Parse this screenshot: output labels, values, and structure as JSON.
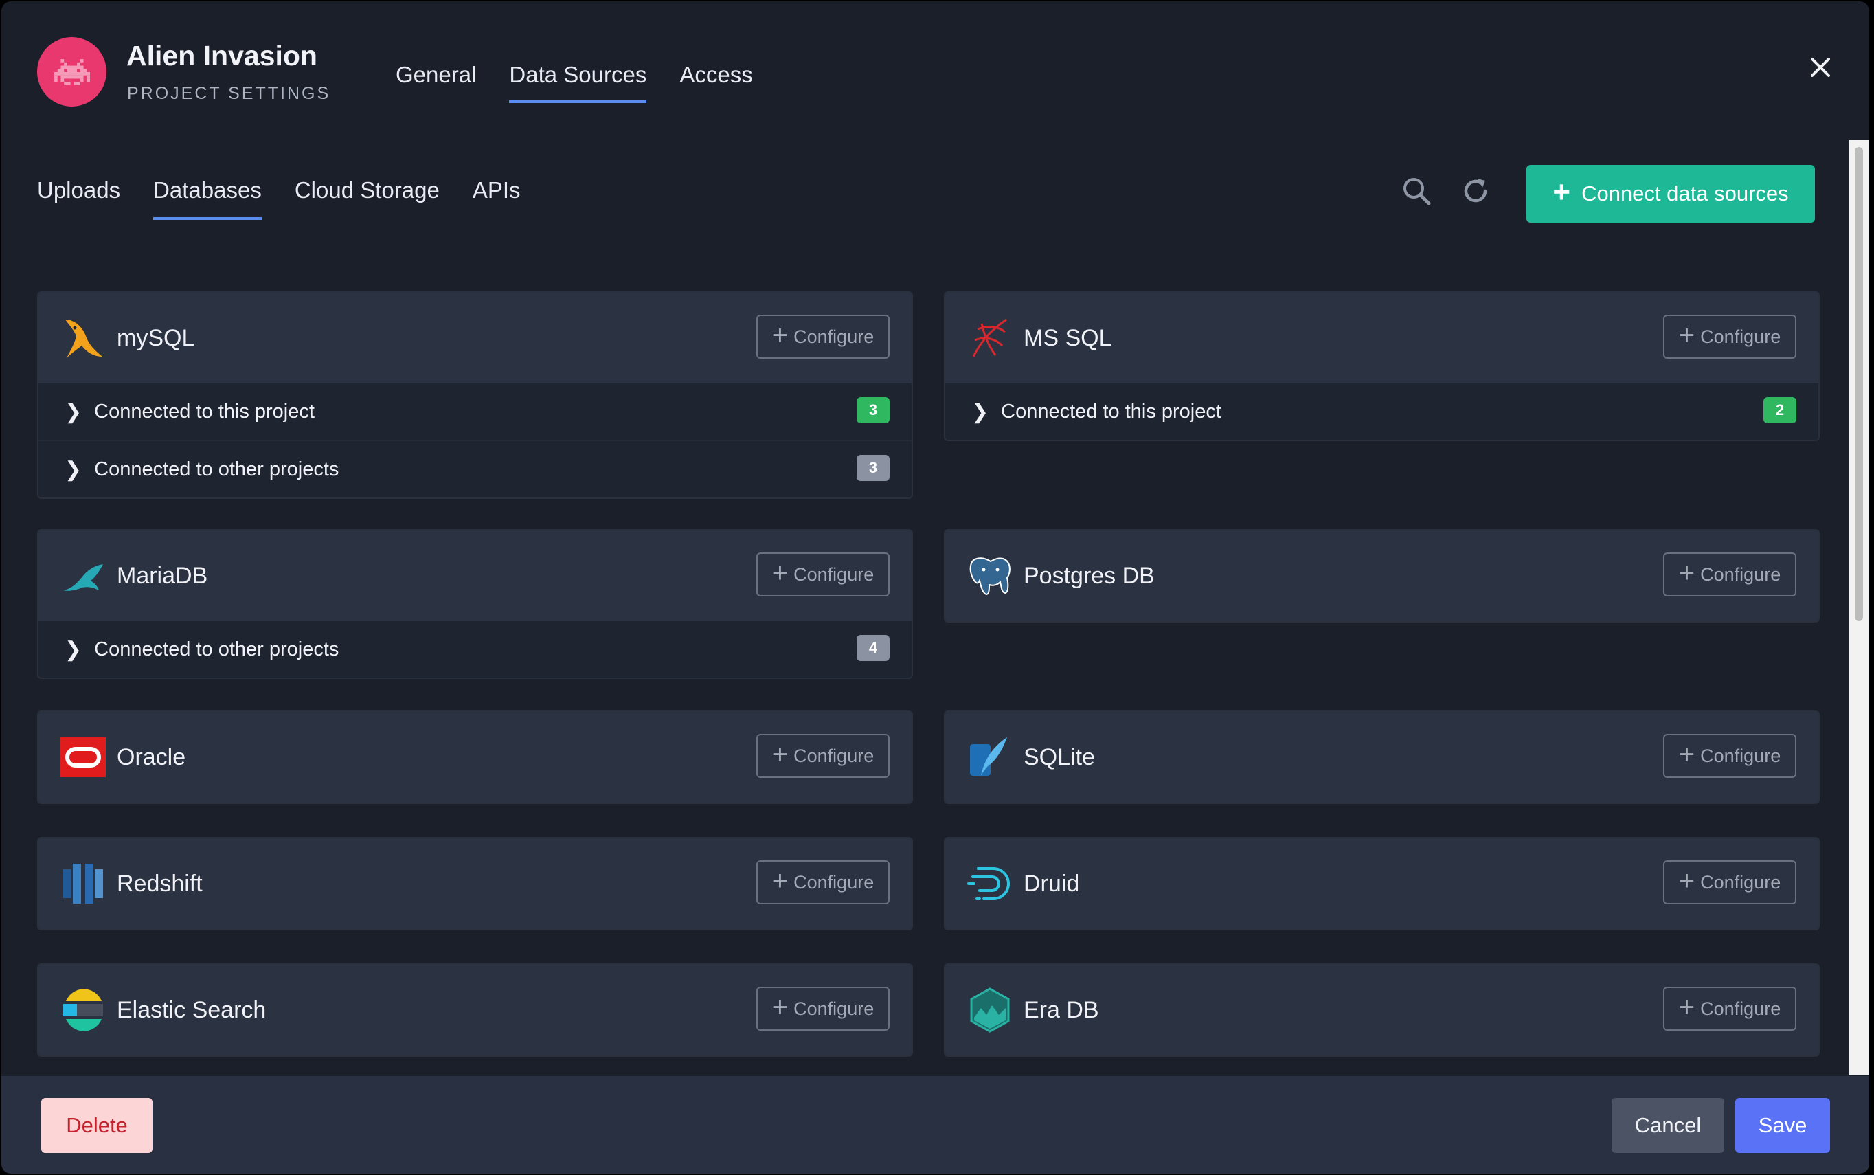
{
  "project": {
    "name": "Alien Invasion",
    "subtitle": "PROJECT SETTINGS"
  },
  "main_tabs": [
    {
      "label": "General",
      "active": false
    },
    {
      "label": "Data Sources",
      "active": true
    },
    {
      "label": "Access",
      "active": false
    }
  ],
  "sub_tabs": [
    {
      "label": "Uploads",
      "active": false
    },
    {
      "label": "Databases",
      "active": true
    },
    {
      "label": "Cloud Storage",
      "active": false
    },
    {
      "label": "APIs",
      "active": false
    }
  ],
  "toolbar": {
    "connect_label": "Connect data sources"
  },
  "configure_label": "Configure",
  "sources": [
    {
      "name": "mySQL",
      "icon": "mysql-dolphin-icon",
      "rows": [
        {
          "label": "Connected to this project",
          "count": "3",
          "badge": "green"
        },
        {
          "label": "Connected to other projects",
          "count": "3",
          "badge": "gray"
        }
      ]
    },
    {
      "name": "MS SQL",
      "icon": "mssql-icon",
      "rows": [
        {
          "label": "Connected to this project",
          "count": "2",
          "badge": "green"
        }
      ]
    },
    {
      "name": "MariaDB",
      "icon": "mariadb-seal-icon",
      "rows": [
        {
          "label": "Connected to other projects",
          "count": "4",
          "badge": "gray"
        }
      ]
    },
    {
      "name": "Postgres DB",
      "icon": "postgres-elephant-icon",
      "rows": []
    },
    {
      "name": "Oracle",
      "icon": "oracle-icon",
      "rows": []
    },
    {
      "name": "SQLite",
      "icon": "sqlite-feather-icon",
      "rows": []
    },
    {
      "name": "Redshift",
      "icon": "redshift-icon",
      "rows": []
    },
    {
      "name": "Druid",
      "icon": "druid-icon",
      "rows": []
    },
    {
      "name": "Elastic Search",
      "icon": "elasticsearch-icon",
      "rows": []
    },
    {
      "name": "Era DB",
      "icon": "eradb-icon",
      "rows": []
    }
  ],
  "footer": {
    "delete_label": "Delete",
    "cancel_label": "Cancel",
    "save_label": "Save"
  },
  "colors": {
    "accent": "#5b8cf0",
    "connect": "#1fb896",
    "save": "#5972f6",
    "delete_bg": "#fcd5d7",
    "delete_text": "#c2232d",
    "badge_green": "#2fb85f",
    "badge_gray": "#8b92a2"
  }
}
